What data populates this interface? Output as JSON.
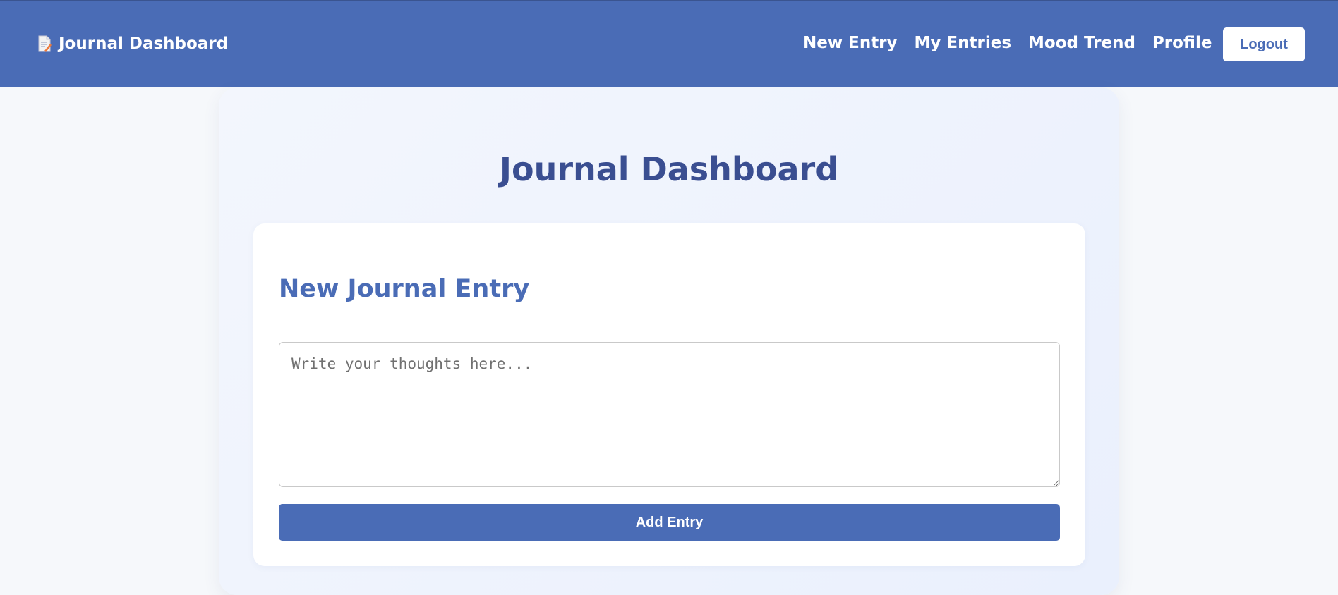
{
  "navbar": {
    "brand_icon": "memo-icon",
    "brand_label": "Journal Dashboard",
    "links": [
      {
        "label": "New Entry"
      },
      {
        "label": "My Entries"
      },
      {
        "label": "Mood Trend"
      },
      {
        "label": "Profile"
      }
    ],
    "logout_label": "Logout"
  },
  "main": {
    "title": "Journal Dashboard",
    "card": {
      "title": "New Journal Entry",
      "textarea": {
        "value": "",
        "placeholder": "Write your thoughts here..."
      },
      "submit_label": "Add Entry"
    }
  },
  "colors": {
    "primary": "#4a6cb6",
    "title": "#3a4e91",
    "background": "#f6f8fb",
    "card": "#ffffff"
  }
}
